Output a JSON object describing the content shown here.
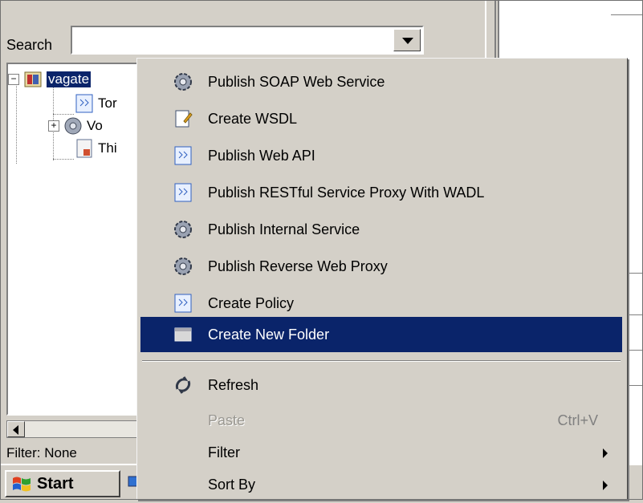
{
  "search": {
    "label": "Search",
    "value": ""
  },
  "tree": {
    "items": [
      {
        "label": "vagate",
        "icon": "folder-icon",
        "selected": true
      },
      {
        "label": "Tor",
        "icon": "policy-icon"
      },
      {
        "label": "Vo",
        "icon": "service-gear-icon"
      },
      {
        "label": "Thi",
        "icon": "document-icon"
      }
    ]
  },
  "filter_text": "Filter: None",
  "taskbar": {
    "start_label": "Start"
  },
  "context_menu": {
    "items": [
      {
        "label": "Publish SOAP Web Service",
        "icon": "gear-icon"
      },
      {
        "label": "Create WSDL",
        "icon": "wsdl-document-icon"
      },
      {
        "label": "Publish Web API",
        "icon": "policy-document-icon"
      },
      {
        "label": "Publish RESTful Service Proxy With WADL",
        "icon": "policy-document-icon"
      },
      {
        "label": "Publish Internal Service",
        "icon": "gear-icon"
      },
      {
        "label": "Publish Reverse Web Proxy",
        "icon": "gear-icon"
      },
      {
        "label": "Create Policy",
        "icon": "policy-document-icon"
      },
      {
        "label": "Create New Folder",
        "icon": "folder-icon",
        "highlighted": true
      },
      {
        "label": "Refresh",
        "icon": "refresh-icon"
      },
      {
        "label": "Paste",
        "shortcut": "Ctrl+V",
        "disabled": true
      },
      {
        "label": "Filter",
        "submenu": true
      },
      {
        "label": "Sort By",
        "submenu": true
      }
    ]
  },
  "colors": {
    "highlight": "#0a246a",
    "face": "#d4d0c8",
    "disabled_text": "#9a9892"
  }
}
